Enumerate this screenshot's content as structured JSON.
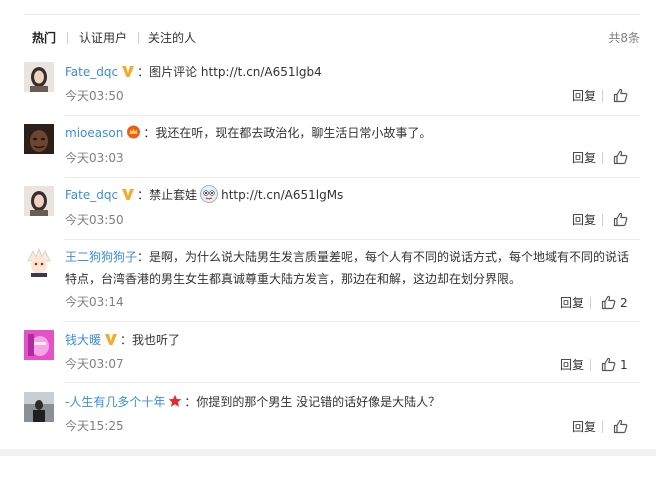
{
  "tabs": [
    "热门",
    "认证用户",
    "关注的人"
  ],
  "total_count": "共8条",
  "reply_label": "回复",
  "colors": {
    "username": "#eb7350",
    "muted": "#808080",
    "verified_badge": "#f4ac2c",
    "like_icon": "#555555"
  },
  "comments": [
    {
      "user": "Fate_dqc",
      "sep": "：",
      "text": "图片评论 http://t.cn/A651lgb4",
      "time": "今天03:50",
      "likes": ""
    },
    {
      "user": "mioeason",
      "sep": "：",
      "text": "我还在听，现在都去政治化，聊生活日常小故事了。",
      "time": "今天03:03",
      "likes": ""
    },
    {
      "user": "Fate_dqc",
      "sep": "：",
      "text_before": "禁止套娃",
      "text_after": "http://t.cn/A651lgMs",
      "time": "今天03:50",
      "likes": ""
    },
    {
      "user": "王二狗狗狗子",
      "sep": "：",
      "text": "是啊，为什么说大陆男生发言质量差呢，每个人有不同的说话方式，每个地域有不同的说话特点，台湾香港的男生女生都真诚尊重大陆方发言，那边在和解，这边却在划分界限。",
      "time": "今天03:14",
      "likes": "2"
    },
    {
      "user": "钱大暖",
      "sep": "：",
      "text": "我也听了",
      "time": "今天03:07",
      "likes": "1"
    },
    {
      "user": "-人生有几多个十年",
      "sep": "：",
      "text": "你提到的那个男生 没记错的话好像是大陆人？",
      "time": "今天15:25",
      "likes": ""
    }
  ]
}
